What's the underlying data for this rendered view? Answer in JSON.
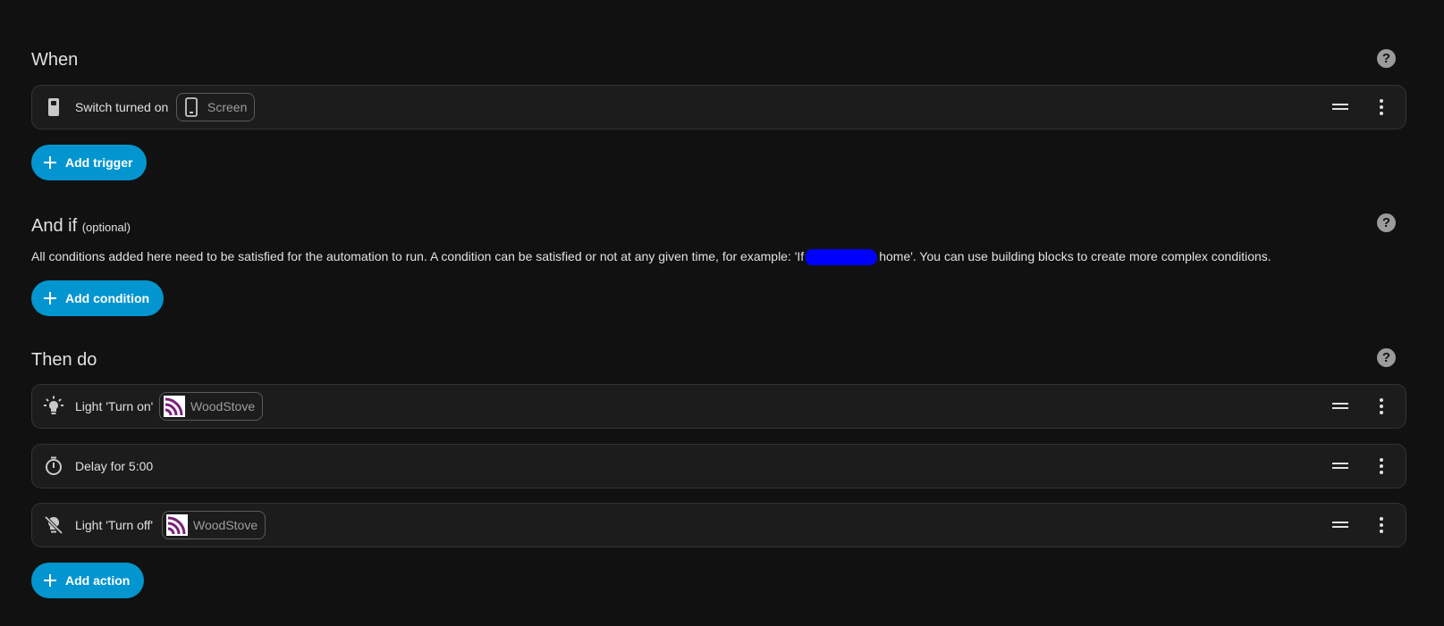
{
  "triggers": {
    "title": "When",
    "items": [
      {
        "label": "Switch turned on",
        "chip": "Screen",
        "icon": "switch-icon",
        "chip_icon": "cellphone-icon"
      }
    ],
    "add_label": "Add trigger"
  },
  "conditions": {
    "title": "And if",
    "optional": "(optional)",
    "desc_before": "All conditions added here need to be satisfied for the automation to run. A condition can be satisfied or not at any given time, for example: 'If",
    "desc_after": "home'. You can use building blocks to create more complex conditions.",
    "add_label": "Add condition"
  },
  "actions": {
    "title": "Then do",
    "items": [
      {
        "label": "Light 'Turn on'",
        "chip": "WoodStove",
        "icon": "lightbulb-on-icon",
        "chip_icon": "woodstove-logo-icon"
      },
      {
        "label": "Delay for 5:00",
        "icon": "timer-icon"
      },
      {
        "label": "Light 'Turn off'",
        "chip": "WoodStove",
        "icon": "lightbulb-off-icon",
        "chip_icon": "woodstove-logo-icon"
      }
    ],
    "add_label": "Add action"
  },
  "colors": {
    "accent": "#0395cf",
    "background": "#111111",
    "card": "#1c1c1c",
    "redaction": "#0000ff",
    "woodstove_logo": "#7a1f7a"
  }
}
